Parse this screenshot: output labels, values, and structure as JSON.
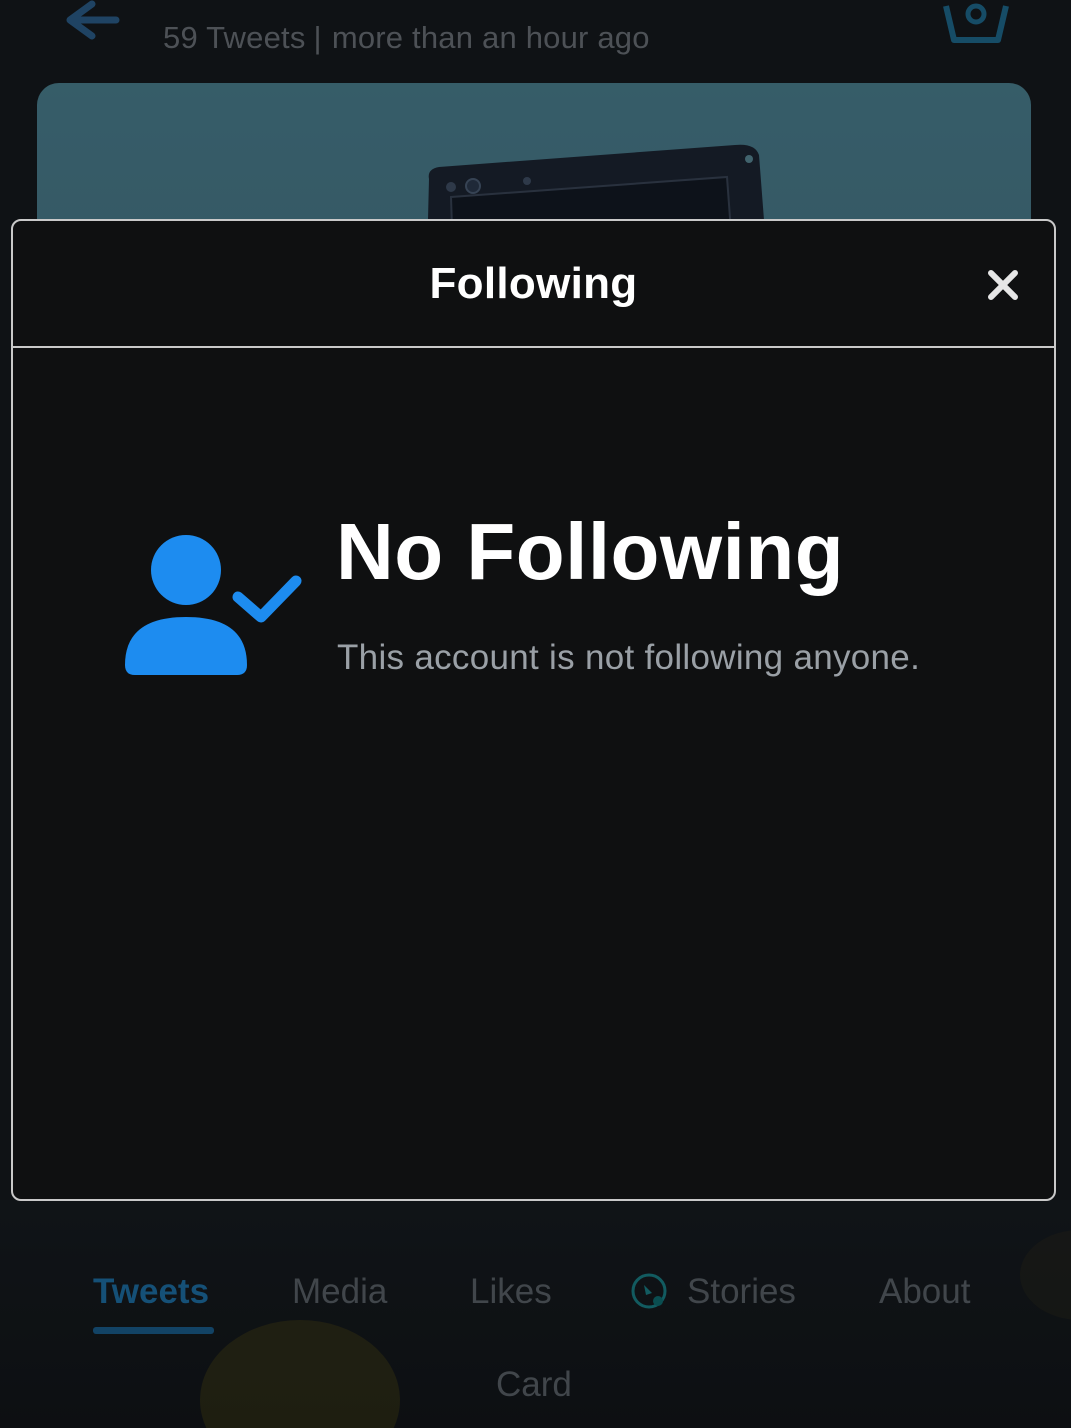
{
  "header": {
    "tweet_count": "59 Tweets",
    "separator": "|",
    "last_active": "more than an hour ago"
  },
  "tabs": [
    {
      "label": "Tweets",
      "active": true
    },
    {
      "label": "Media",
      "active": false
    },
    {
      "label": "Likes",
      "active": false
    },
    {
      "label": "Stories",
      "active": false,
      "icon": "stories-icon"
    },
    {
      "label": "About",
      "active": false
    },
    {
      "label": "Card",
      "active": false
    }
  ],
  "modal": {
    "title": "Following",
    "close_icon": "close-icon",
    "empty_state": {
      "icon": "user-check-icon",
      "title": "No Following",
      "subtitle": "This account is not following anyone."
    }
  },
  "colors": {
    "accent": "#1d8cf0",
    "active_tab": "#1e6fa6",
    "modal_bg": "#0f1011",
    "modal_border": "#c9c9c9"
  }
}
